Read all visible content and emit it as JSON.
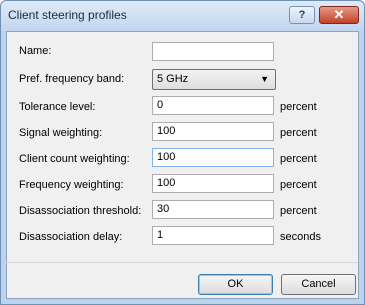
{
  "window": {
    "title": "Client steering profiles"
  },
  "titlebar": {
    "help": "?",
    "close": "✕"
  },
  "form": {
    "name": {
      "label": "Name:",
      "value": ""
    },
    "pref_band": {
      "label": "Pref. frequency band:",
      "value": "5 GHz"
    },
    "tolerance": {
      "label": "Tolerance level:",
      "value": "0",
      "unit": "percent"
    },
    "signal": {
      "label": "Signal weighting:",
      "value": "100",
      "unit": "percent"
    },
    "client_count": {
      "label": "Client count weighting:",
      "value": "100",
      "unit": "percent"
    },
    "frequency": {
      "label": "Frequency weighting:",
      "value": "100",
      "unit": "percent"
    },
    "disassoc_threshold": {
      "label": "Disassociation threshold:",
      "value": "30",
      "unit": "percent"
    },
    "disassoc_delay": {
      "label": "Disassociation delay:",
      "value": "1",
      "unit": "seconds"
    }
  },
  "buttons": {
    "ok": "OK",
    "cancel": "Cancel"
  },
  "colors": {
    "frame": "#bcd3ec",
    "close": "#c2412a",
    "client": "#f0f0f0"
  }
}
